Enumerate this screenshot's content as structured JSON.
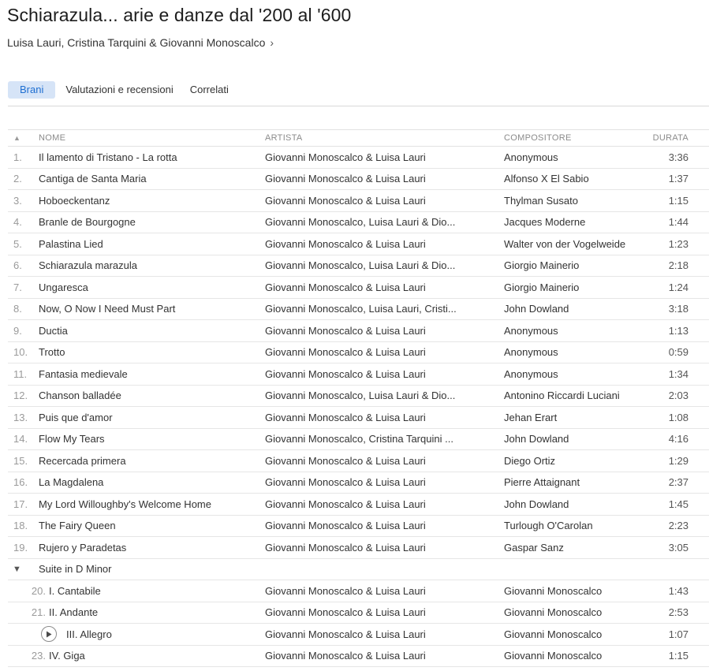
{
  "album": {
    "title": "Schiarazula... arie e danze dal '200 al '600",
    "artist": "Luisa Lauri, Cristina Tarquini & Giovanni Monoscalco",
    "chevron": "›"
  },
  "tabs": [
    {
      "label": "Brani",
      "active": true
    },
    {
      "label": "Valutazioni e recensioni",
      "active": false
    },
    {
      "label": "Correlati",
      "active": false
    }
  ],
  "table": {
    "sort_indicator": "▲",
    "columns": {
      "name": "NOME",
      "artist": "ARTISTA",
      "composer": "COMPOSITORE",
      "duration": "DURATA"
    },
    "rows": [
      {
        "num": "1.",
        "name": "Il lamento di Tristano - La rotta",
        "artist": "Giovanni Monoscalco & Luisa Lauri",
        "composer": "Anonymous",
        "duration": "3:36"
      },
      {
        "num": "2.",
        "name": "Cantiga de Santa Maria",
        "artist": "Giovanni Monoscalco & Luisa Lauri",
        "composer": "Alfonso X El Sabio",
        "duration": "1:37"
      },
      {
        "num": "3.",
        "name": "Hoboeckentanz",
        "artist": "Giovanni Monoscalco & Luisa Lauri",
        "composer": "Thylman Susato",
        "duration": "1:15"
      },
      {
        "num": "4.",
        "name": "Branle de Bourgogne",
        "artist": "Giovanni Monoscalco, Luisa Lauri & Dio...",
        "composer": "Jacques Moderne",
        "duration": "1:44"
      },
      {
        "num": "5.",
        "name": "Palastina Lied",
        "artist": "Giovanni Monoscalco & Luisa Lauri",
        "composer": "Walter von der Vogelweide",
        "duration": "1:23"
      },
      {
        "num": "6.",
        "name": "Schiarazula marazula",
        "artist": "Giovanni Monoscalco, Luisa Lauri & Dio...",
        "composer": "Giorgio Mainerio",
        "duration": "2:18"
      },
      {
        "num": "7.",
        "name": "Ungaresca",
        "artist": "Giovanni Monoscalco & Luisa Lauri",
        "composer": "Giorgio Mainerio",
        "duration": "1:24"
      },
      {
        "num": "8.",
        "name": "Now, O Now I Need Must Part",
        "artist": "Giovanni Monoscalco, Luisa Lauri, Cristi...",
        "composer": "John Dowland",
        "duration": "3:18"
      },
      {
        "num": "9.",
        "name": "Ductia",
        "artist": "Giovanni Monoscalco & Luisa Lauri",
        "composer": "Anonymous",
        "duration": "1:13"
      },
      {
        "num": "10.",
        "name": "Trotto",
        "artist": "Giovanni Monoscalco & Luisa Lauri",
        "composer": "Anonymous",
        "duration": "0:59"
      },
      {
        "num": "11.",
        "name": "Fantasia medievale",
        "artist": "Giovanni Monoscalco & Luisa Lauri",
        "composer": "Anonymous",
        "duration": "1:34"
      },
      {
        "num": "12.",
        "name": "Chanson balladée",
        "artist": "Giovanni Monoscalco, Luisa Lauri & Dio...",
        "composer": "Antonino Riccardi Luciani",
        "duration": "2:03"
      },
      {
        "num": "13.",
        "name": "Puis que d'amor",
        "artist": "Giovanni Monoscalco & Luisa Lauri",
        "composer": "Jehan Erart",
        "duration": "1:08"
      },
      {
        "num": "14.",
        "name": "Flow My Tears",
        "artist": "Giovanni Monoscalco, Cristina Tarquini ...",
        "composer": "John Dowland",
        "duration": "4:16"
      },
      {
        "num": "15.",
        "name": "Recercada primera",
        "artist": "Giovanni Monoscalco & Luisa Lauri",
        "composer": "Diego Ortiz",
        "duration": "1:29"
      },
      {
        "num": "16.",
        "name": "La Magdalena",
        "artist": "Giovanni Monoscalco & Luisa Lauri",
        "composer": "Pierre Attaignant",
        "duration": "2:37"
      },
      {
        "num": "17.",
        "name": "My Lord Willoughby's Welcome Home",
        "artist": "Giovanni Monoscalco & Luisa Lauri",
        "composer": "John Dowland",
        "duration": "1:45"
      },
      {
        "num": "18.",
        "name": "The Fairy Queen",
        "artist": "Giovanni Monoscalco & Luisa Lauri",
        "composer": "Turlough O'Carolan",
        "duration": "2:23"
      },
      {
        "num": "19.",
        "name": "Rujero y Paradetas",
        "artist": "Giovanni Monoscalco & Luisa Lauri",
        "composer": "Gaspar Sanz",
        "duration": "3:05"
      }
    ],
    "suite": {
      "toggle": "▼",
      "name": "Suite in D Minor",
      "tracks": [
        {
          "num": "20.",
          "name": "I. Cantabile",
          "artist": "Giovanni Monoscalco & Luisa Lauri",
          "composer": "Giovanni Monoscalco",
          "duration": "1:43"
        },
        {
          "num": "21.",
          "name": "II. Andante",
          "artist": "Giovanni Monoscalco & Luisa Lauri",
          "composer": "Giovanni Monoscalco",
          "duration": "2:53"
        },
        {
          "num": "",
          "name": "III. Allegro",
          "artist": "Giovanni Monoscalco & Luisa Lauri",
          "composer": "Giovanni Monoscalco",
          "duration": "1:07",
          "play_icon": "play-circle-icon"
        },
        {
          "num": "23.",
          "name": "IV. Giga",
          "artist": "Giovanni Monoscalco & Luisa Lauri",
          "composer": "Giovanni Monoscalco",
          "duration": "1:15"
        }
      ]
    }
  },
  "colors": {
    "tab_active_bg": "#d6e4f7",
    "tab_active_text": "#1f6fd1"
  }
}
